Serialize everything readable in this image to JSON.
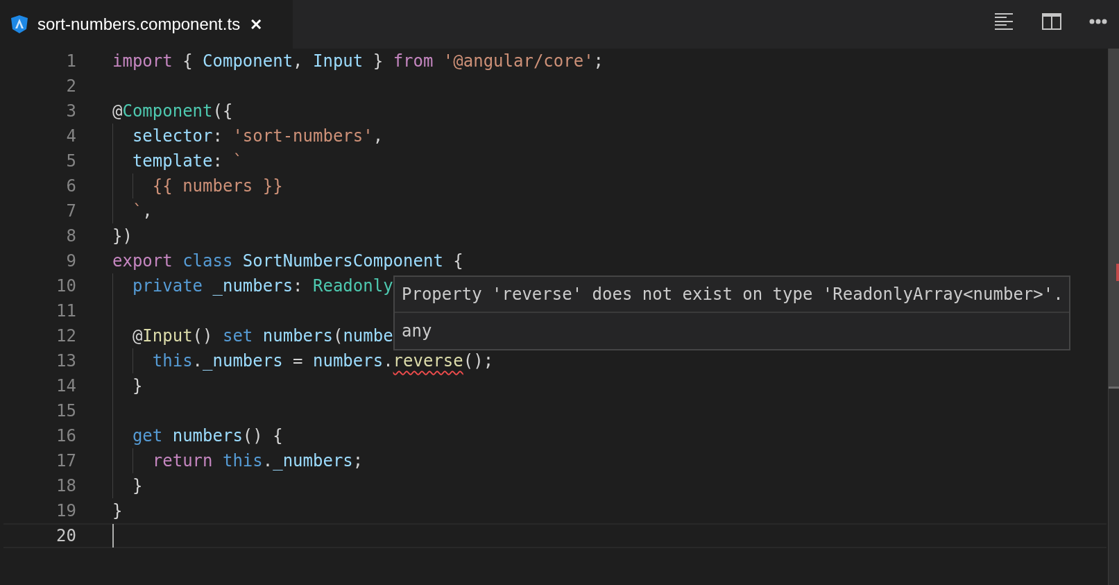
{
  "tabs": [
    {
      "label": "sort-numbers.component.ts",
      "selected": true,
      "close": "✕"
    }
  ],
  "toolbar": [
    {
      "kind": "lines"
    },
    {
      "kind": "split"
    },
    {
      "kind": "more"
    }
  ],
  "lines": [
    {
      "number": "1",
      "tokens": [
        {
          "t": "import",
          "kind": "keyword"
        },
        {
          "t": " { ",
          "kind": "plain"
        },
        {
          "t": "Component",
          "kind": "variable"
        },
        {
          "t": ", ",
          "kind": "plain"
        },
        {
          "t": "Input",
          "kind": "variable"
        },
        {
          "t": " } ",
          "kind": "plain"
        },
        {
          "t": "from",
          "kind": "keyword"
        },
        {
          "t": " '@angular/core'",
          "kind": "string"
        },
        {
          "t": ";",
          "kind": "plain"
        }
      ]
    },
    {
      "number": "2"
    },
    {
      "number": "3",
      "tokens": [
        {
          "t": "@",
          "kind": "plain"
        },
        {
          "t": "Component",
          "kind": "type"
        },
        {
          "t": "({",
          "kind": "plain"
        }
      ]
    },
    {
      "number": "4",
      "tokens": [
        {
          "t": "  selector",
          "kind": "variable"
        },
        {
          "t": ": ",
          "kind": "plain"
        },
        {
          "t": "'sort-numbers'",
          "kind": "string"
        },
        {
          "t": ",",
          "kind": "plain"
        }
      ]
    },
    {
      "number": "5",
      "tokens": [
        {
          "t": "  template",
          "kind": "variable"
        },
        {
          "t": ": ",
          "kind": "plain"
        },
        {
          "t": "`",
          "kind": "string"
        }
      ]
    },
    {
      "number": "6",
      "tokens": [
        {
          "t": "    {{ numbers }}",
          "kind": "string"
        }
      ]
    },
    {
      "number": "7",
      "tokens": [
        {
          "t": "  `",
          "kind": "string"
        },
        {
          "t": ",",
          "kind": "plain"
        }
      ]
    },
    {
      "number": "8",
      "tokens": [
        {
          "t": "})",
          "kind": "plain"
        }
      ]
    },
    {
      "number": "9",
      "tokens": [
        {
          "t": "export",
          "kind": "keyword"
        },
        {
          "t": " class",
          "kind": "storage"
        },
        {
          "t": " SortNumbersComponent",
          "kind": "variable"
        },
        {
          "t": " {",
          "kind": "plain"
        }
      ]
    },
    {
      "number": "10",
      "tokens": [
        {
          "t": "  private",
          "kind": "storage"
        },
        {
          "t": " _numbers",
          "kind": "variable"
        },
        {
          "t": ": ",
          "kind": "plain"
        },
        {
          "t": "Readonly",
          "kind": "type"
        }
      ]
    },
    {
      "number": "11"
    },
    {
      "number": "12",
      "tokens": [
        {
          "t": "  @",
          "kind": "plain"
        },
        {
          "t": "Input",
          "kind": "function"
        },
        {
          "t": "() ",
          "kind": "plain"
        },
        {
          "t": "set",
          "kind": "storage"
        },
        {
          "t": " numbers",
          "kind": "variable"
        },
        {
          "t": "(",
          "kind": "plain"
        },
        {
          "t": "numbe",
          "kind": "variable"
        }
      ]
    },
    {
      "number": "13",
      "tokens": [
        {
          "t": "    this",
          "kind": "storage"
        },
        {
          "t": ".",
          "kind": "plain"
        },
        {
          "t": "_numbers",
          "kind": "variable"
        },
        {
          "t": " = ",
          "kind": "plain"
        },
        {
          "t": "numbers",
          "kind": "variable"
        },
        {
          "t": ".",
          "kind": "plain"
        },
        {
          "t": "reverse",
          "kind": "function",
          "error": true
        },
        {
          "t": "();",
          "kind": "plain"
        }
      ]
    },
    {
      "number": "14",
      "tokens": [
        {
          "t": "  }",
          "kind": "plain"
        }
      ]
    },
    {
      "number": "15"
    },
    {
      "number": "16",
      "tokens": [
        {
          "t": "  get",
          "kind": "storage"
        },
        {
          "t": " numbers",
          "kind": "variable"
        },
        {
          "t": "() {",
          "kind": "plain"
        }
      ]
    },
    {
      "number": "17",
      "tokens": [
        {
          "t": "    return",
          "kind": "keyword"
        },
        {
          "t": " this",
          "kind": "storage"
        },
        {
          "t": ".",
          "kind": "plain"
        },
        {
          "t": "_numbers",
          "kind": "variable"
        },
        {
          "t": ";",
          "kind": "plain"
        }
      ]
    },
    {
      "number": "18",
      "tokens": [
        {
          "t": "  }",
          "kind": "plain"
        }
      ]
    },
    {
      "number": "19",
      "tokens": [
        {
          "t": "}",
          "kind": "plain"
        }
      ]
    },
    {
      "number": "20",
      "current": true
    }
  ],
  "hover": {
    "message": "Property 'reverse' does not exist on type 'ReadonlyArray<number>'.",
    "type": "any"
  }
}
